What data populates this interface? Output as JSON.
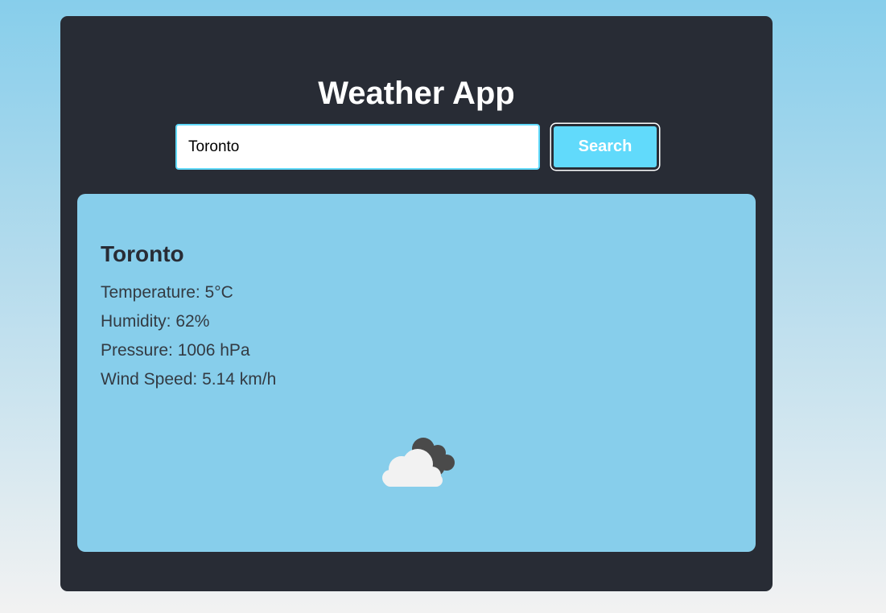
{
  "app": {
    "title": "Weather App"
  },
  "search": {
    "value": "Toronto",
    "button_label": "Search"
  },
  "weather": {
    "city": "Toronto",
    "temperature": "Temperature: 5°C",
    "humidity": "Humidity: 62%",
    "pressure": "Pressure: 1006 hPa",
    "wind_speed": "Wind Speed: 5.14 km/h",
    "icon": "broken-clouds-icon"
  },
  "colors": {
    "page_gradient_top": "#87ceeb",
    "page_gradient_bottom": "#f2f2f2",
    "panel_background": "#282c35",
    "accent": "#61dafb",
    "card_background": "#87ceeb",
    "text_dark": "#282c35"
  }
}
